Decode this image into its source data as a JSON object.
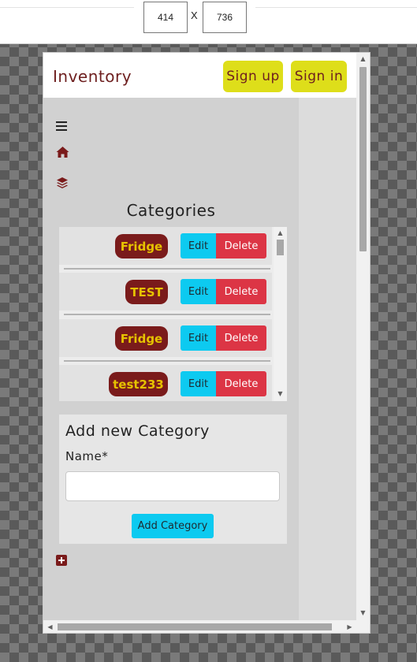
{
  "devtools": {
    "width": "414",
    "separator": "X",
    "height": "736"
  },
  "navbar": {
    "brand": "Inventory",
    "signup_label": "Sign up",
    "signin_label": "Sign in"
  },
  "sidebar": {
    "menu_icon": "hamburger-icon",
    "home_icon": "home-icon",
    "layers_icon": "layers-icon",
    "categories_title": "Categories",
    "add_icon": "plus-square-icon"
  },
  "categories": [
    {
      "name": "Fridge",
      "edit_label": "Edit",
      "delete_label": "Delete"
    },
    {
      "name": "TEST",
      "edit_label": "Edit",
      "delete_label": "Delete"
    },
    {
      "name": "Fridge",
      "edit_label": "Edit",
      "delete_label": "Delete"
    },
    {
      "name": "test233",
      "edit_label": "Edit",
      "delete_label": "Delete"
    }
  ],
  "add_form": {
    "title": "Add new Category",
    "name_label": "Name*",
    "name_value": "",
    "submit_label": "Add Category"
  },
  "colors": {
    "brand": "#6e1f1f",
    "nav_button": "#dede1a",
    "badge_bg": "#7a1b1b",
    "badge_text": "#e6c200",
    "edit": "#0dcaf0",
    "delete": "#dc3545"
  }
}
